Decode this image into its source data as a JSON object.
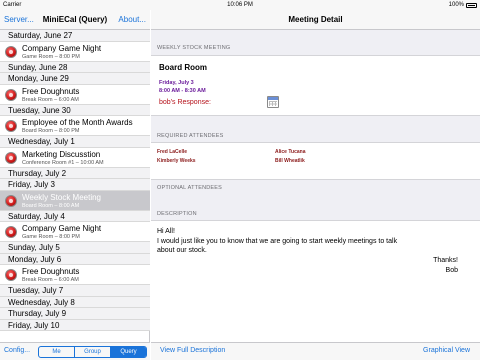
{
  "status_bar": {
    "carrier": "Carrier",
    "time": "10:06 PM",
    "battery": "100%"
  },
  "left_nav": {
    "server_label": "Server...",
    "title": "MiniECal (Query)",
    "about_label": "About..."
  },
  "event_list": {
    "rows": [
      {
        "kind": "header",
        "label": "Saturday, June 27"
      },
      {
        "kind": "event",
        "title": "Company Game Night",
        "detail": "Game Room – 8:00 PM"
      },
      {
        "kind": "header",
        "label": "Sunday, June 28"
      },
      {
        "kind": "header",
        "label": "Monday, June 29"
      },
      {
        "kind": "event",
        "title": "Free Doughnuts",
        "detail": "Break Room – 6:00 AM"
      },
      {
        "kind": "header",
        "label": "Tuesday, June 30"
      },
      {
        "kind": "event",
        "title": "Employee of the Month Awards",
        "detail": "Board Room – 8:00 PM"
      },
      {
        "kind": "header",
        "label": "Wednesday, July 1"
      },
      {
        "kind": "event",
        "title": "Marketing Discusstion",
        "detail": "Conference Room #1 – 10:00 AM"
      },
      {
        "kind": "header",
        "label": "Thursday, July 2"
      },
      {
        "kind": "header",
        "label": "Friday, July 3"
      },
      {
        "kind": "event",
        "title": "Weekly Stock Meeting",
        "detail": "Board Room – 8:00 AM",
        "selected": true
      },
      {
        "kind": "header",
        "label": "Saturday, July 4"
      },
      {
        "kind": "event",
        "title": "Company Game Night",
        "detail": "Game Room – 8:00 PM"
      },
      {
        "kind": "header",
        "label": "Sunday, July 5"
      },
      {
        "kind": "header",
        "label": "Monday, July 6"
      },
      {
        "kind": "event",
        "title": "Free Doughnuts",
        "detail": "Break Room – 6:00 AM"
      },
      {
        "kind": "header",
        "label": "Tuesday, July 7"
      },
      {
        "kind": "header",
        "label": "Wednesday, July 8"
      },
      {
        "kind": "header",
        "label": "Thursday, July 9"
      },
      {
        "kind": "header",
        "label": "Friday, July 10"
      }
    ]
  },
  "left_toolbar": {
    "config_label": "Config...",
    "segments": [
      {
        "label": "Me",
        "selected": false
      },
      {
        "label": "Group",
        "selected": false
      },
      {
        "label": "Query",
        "selected": true
      }
    ]
  },
  "detail": {
    "nav_title": "Meeting Detail",
    "section_meeting": "WEEKLY STOCK MEETING",
    "location": "Board Room",
    "date": "Friday, July 3",
    "time": "8:00 AM - 8:30 AM",
    "response_label": "bob's Response:",
    "section_required": "REQUIRED ATTENDEES",
    "required_attendees": [
      "Fred LaCelle",
      "Alice Tucana",
      "Kimberly Weeks",
      "Bill Wheatlik"
    ],
    "section_optional": "OPTIONAL ATTENDEES",
    "section_description": "DESCRIPTION",
    "description_lines": [
      "Hi All!",
      "I would just like you to know that we are going to start weekly meetings to talk",
      "about our stock."
    ],
    "signoff": [
      "Thanks!",
      "Bob"
    ]
  },
  "right_toolbar": {
    "full_description_label": "View Full Description",
    "graphical_view_label": "Graphical View"
  },
  "colors": {
    "accent": "#1a73d9",
    "response": "#b5121b",
    "attendee": "#8b1a1a",
    "datetime": "#6a1b9a",
    "event_dot": "#d01c1c"
  }
}
